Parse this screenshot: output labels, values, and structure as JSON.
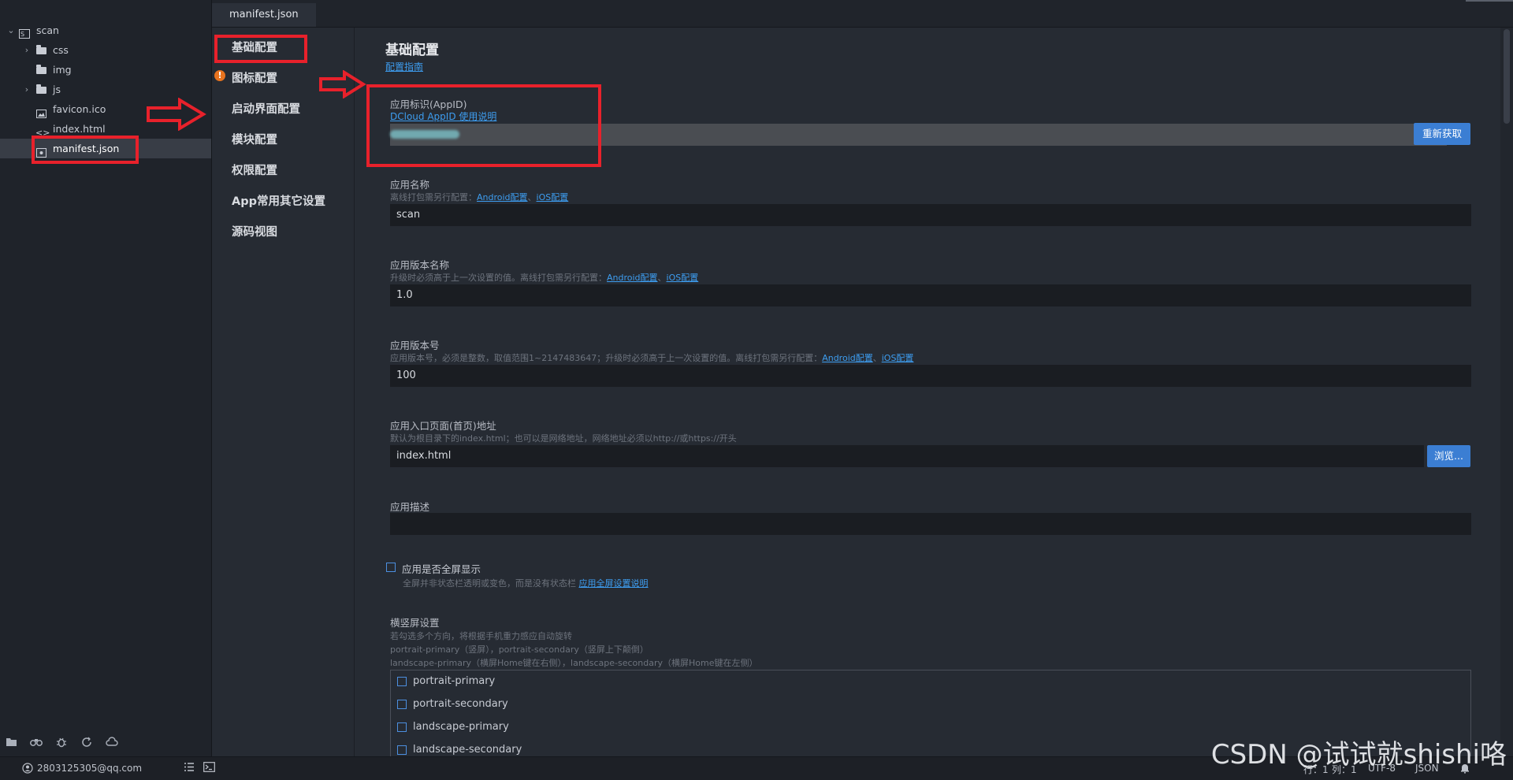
{
  "explorer": {
    "project": "scan",
    "items": [
      {
        "label": "css",
        "type": "folder"
      },
      {
        "label": "img",
        "type": "folder"
      },
      {
        "label": "js",
        "type": "folder"
      },
      {
        "label": "favicon.ico",
        "type": "image"
      },
      {
        "label": "index.html",
        "type": "html"
      },
      {
        "label": "manifest.json",
        "type": "json",
        "selected": true
      }
    ],
    "tools": [
      "files-icon",
      "binoculars-icon",
      "bug-icon",
      "sync-icon",
      "cloud-icon"
    ]
  },
  "tabs": [
    {
      "label": "manifest.json",
      "active": true
    }
  ],
  "nav": {
    "items": [
      "基础配置",
      "图标配置",
      "启动界面配置",
      "模块配置",
      "权限配置",
      "App常用其它设置",
      "源码视图"
    ],
    "warning_item": "图标配置"
  },
  "page": {
    "title": "基础配置",
    "guide": "配置指南"
  },
  "appid": {
    "label": "应用标识(AppID)",
    "help_link": "DCloud AppID 使用说明",
    "value": "",
    "button": "重新获取"
  },
  "app_name": {
    "label": "应用名称",
    "hint": "离线打包需另行配置：",
    "android_link": "Android配置",
    "sep": "、",
    "ios_link": "iOS配置",
    "value": "scan"
  },
  "version_name": {
    "label": "应用版本名称",
    "hint": "升级时必须高于上一次设置的值。离线打包需另行配置：",
    "android_link": "Android配置",
    "sep": "、",
    "ios_link": "iOS配置",
    "value": "1.0"
  },
  "version_code": {
    "label": "应用版本号",
    "hint": "应用版本号，必须是整数，取值范围1~2147483647；升级时必须高于上一次设置的值。离线打包需另行配置：",
    "android_link": "Android配置",
    "sep": "、",
    "ios_link": "iOS配置",
    "value": "100"
  },
  "entry": {
    "label": "应用入口页面(首页)地址",
    "hint": "默认为根目录下的index.html；也可以是网络地址，网络地址必须以http://或https://开头",
    "value": "index.html",
    "button": "浏览..."
  },
  "description": {
    "label": "应用描述",
    "value": ""
  },
  "fullscreen": {
    "label": "应用是否全屏显示",
    "hint": "全屏并非状态栏透明或变色，而是没有状态栏",
    "link": "应用全屏设置说明",
    "checked": false
  },
  "orientation": {
    "label": "横竖屏设置",
    "hint1": "若勾选多个方向，将根据手机重力感应自动旋转",
    "hint2": "portrait-primary（竖屏），portrait-secondary（竖屏上下颠倒）",
    "hint3": "landscape-primary（横屏Home键在右侧），landscape-secondary（横屏Home键在左侧）",
    "options": [
      "portrait-primary",
      "portrait-secondary",
      "landscape-primary",
      "landscape-secondary"
    ]
  },
  "statusbar": {
    "user": "2803125305@qq.com",
    "row": "行：1",
    "col": "列：1",
    "encoding": "UTF-8",
    "language": "JSON"
  },
  "watermark": "CSDN @试试就shishi咯",
  "colors": {
    "accent": "#3b7ed3",
    "annotation": "#e8212b",
    "warning": "#e8731e"
  }
}
